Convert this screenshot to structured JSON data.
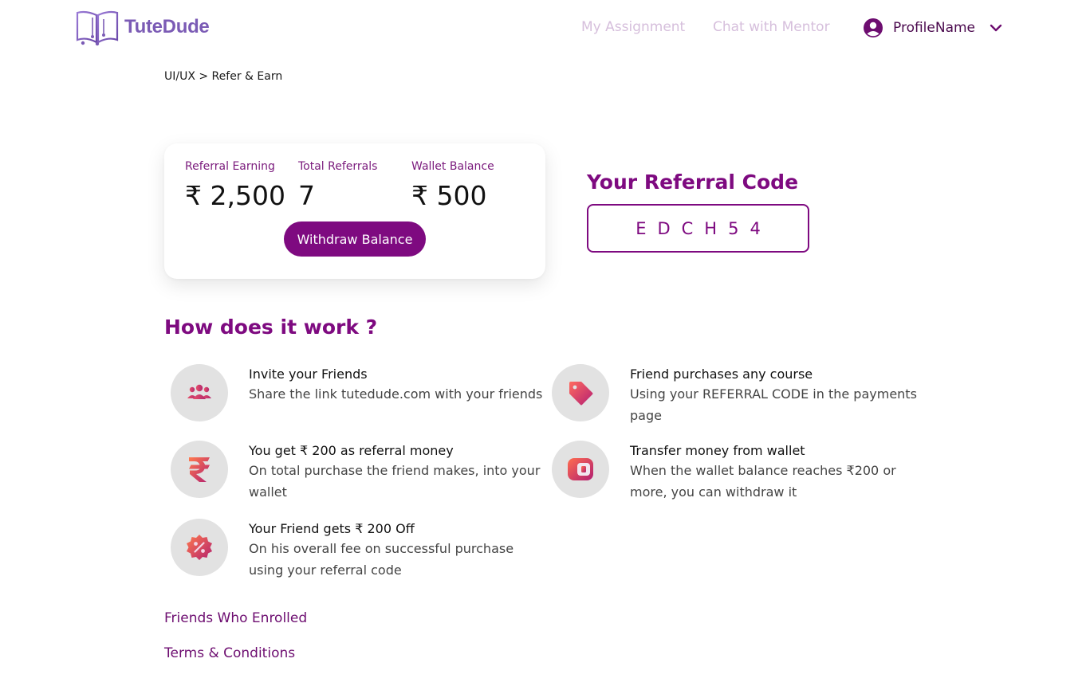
{
  "brand": {
    "name": "TuteDude",
    "color": "#7b5bb5"
  },
  "nav": {
    "my_assignment": "My Assignment",
    "chat_with_mentor": "Chat with Mentor",
    "profile_name": "ProfileName"
  },
  "breadcrumb": "UI/UX > Refer & Earn",
  "stats": {
    "referral_earning_label": "Referral Earning",
    "referral_earning_value": "₹ 2,500",
    "total_referrals_label": "Total Referrals",
    "total_referrals_value": "7",
    "wallet_balance_label": "Wallet Balance",
    "wallet_balance_value": "₹ 500",
    "withdraw_label": "Withdraw Balance"
  },
  "referral": {
    "title": "Your Referral Code",
    "code": "EDCH54"
  },
  "how": {
    "title": "How does it work ?",
    "steps": [
      {
        "icon": "friends-group-icon",
        "title": "Invite your Friends",
        "desc": "Share the link tutedude.com with your friends"
      },
      {
        "icon": "price-tag-icon",
        "title": "Friend purchases any course",
        "desc": "Using your REFERRAL CODE in the payments page"
      },
      {
        "icon": "rupee-icon",
        "title": "You get ₹ 200 as referral money",
        "desc": "On total purchase the friend makes, into your wallet"
      },
      {
        "icon": "wallet-icon",
        "title": "Transfer money from wallet",
        "desc": "When the wallet balance reaches ₹200 or more, you can withdraw it"
      },
      {
        "icon": "discount-badge-icon",
        "title": "Your Friend gets ₹ 200 Off",
        "desc": "On his overall fee on successful purchase using your referral code"
      }
    ]
  },
  "footer": {
    "friends_enrolled": "Friends Who Enrolled",
    "terms": "Terms & Conditions"
  },
  "colors": {
    "primary": "#7e0a80",
    "nav_muted": "#d6bfdc",
    "icon_bg": "#e2e2e2"
  }
}
